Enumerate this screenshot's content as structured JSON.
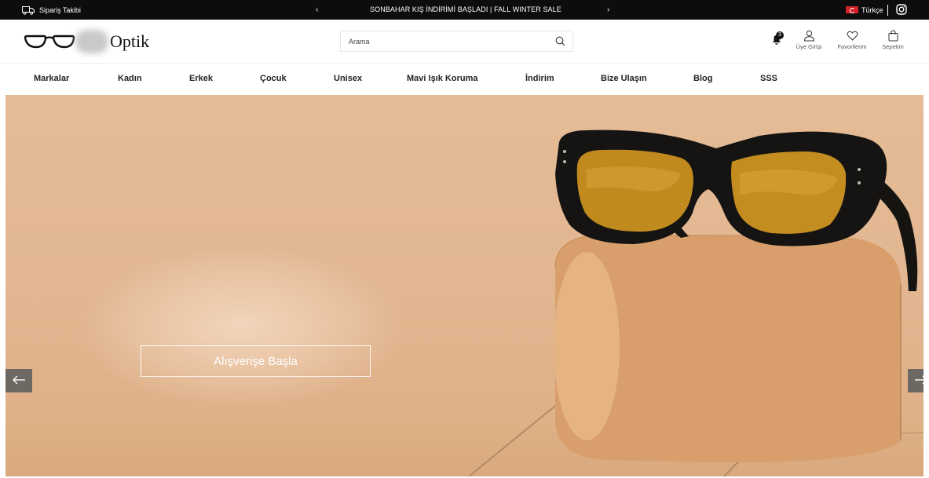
{
  "topbar": {
    "order_tracking": "Sipariş Takibi",
    "announcement": "SONBAHAR KIŞ İNDİRİMİ BAŞLADI | FALL WINTER SALE",
    "prev_arrow": "‹",
    "next_arrow": "›",
    "language": "Türkçe"
  },
  "header": {
    "brand": "Optik",
    "search_placeholder": "Arama",
    "notification_count": "3",
    "login_label": "Üye Girişi",
    "favorites_label": "Favorilerim",
    "cart_label": "Sepetim"
  },
  "nav": {
    "items": [
      "Markalar",
      "Kadın",
      "Erkek",
      "Çocuk",
      "Unisex",
      "Mavi Işık Koruma",
      "İndirim",
      "Bize Ulaşın",
      "Blog",
      "SSS"
    ]
  },
  "hero": {
    "cta_label": "Alışverişe Başla"
  },
  "icons": {
    "truck": "truck-icon",
    "instagram": "instagram-icon",
    "search": "search-icon",
    "bell": "bell-icon",
    "user": "user-icon",
    "heart": "heart-icon",
    "bag": "bag-icon",
    "arrow_left": "arrow-left-icon",
    "arrow_right": "arrow-right-icon"
  },
  "colors": {
    "topbar_bg": "#0d0d0d",
    "hero_bg": "#e2b792",
    "flag": "#d6202a"
  }
}
